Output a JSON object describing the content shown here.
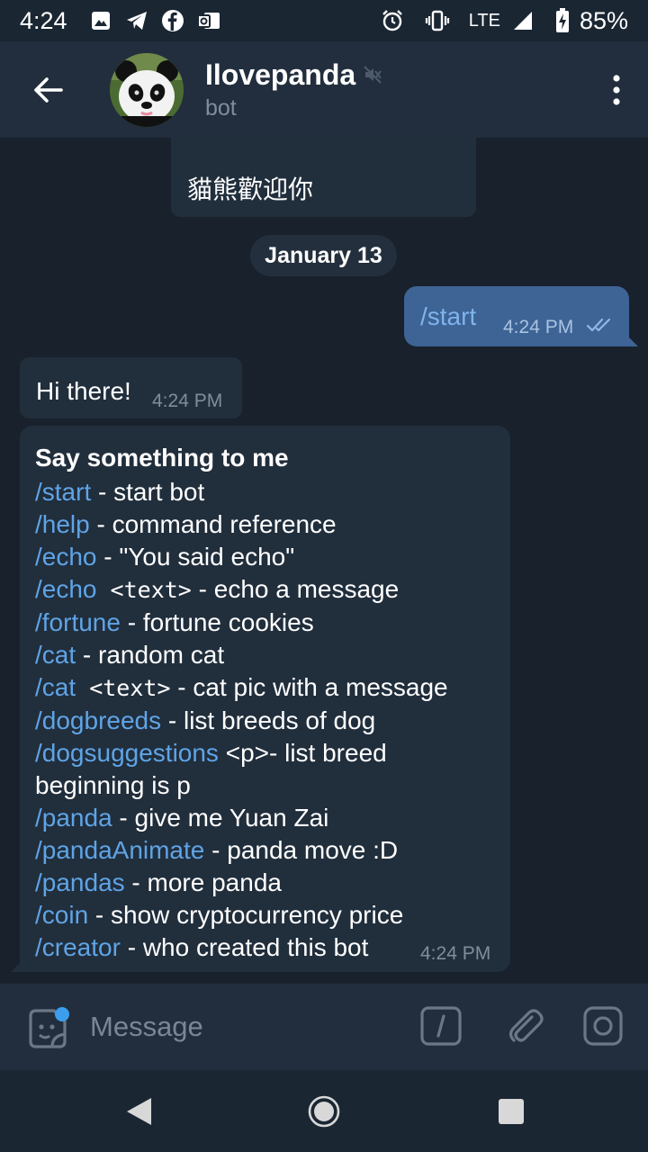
{
  "status_bar": {
    "time": "4:24",
    "network": "LTE",
    "battery": "85%",
    "icons": [
      "gallery-icon",
      "telegram-icon",
      "facebook-icon",
      "outlook-icon",
      "alarm-icon",
      "vibrate-icon",
      "signal-icon",
      "battery-charging-icon"
    ]
  },
  "header": {
    "name": "Ilovepanda",
    "subtitle": "bot",
    "muted": true
  },
  "messages": {
    "top_partial": {
      "text": "貓熊歡迎你"
    },
    "date_separator": "January 13",
    "outgoing": {
      "text": "/start",
      "time": "4:24 PM",
      "status": "read"
    },
    "hi": {
      "text": "Hi there!",
      "time": "4:24 PM"
    },
    "menu": {
      "title": "Say something to me",
      "time": "4:24 PM",
      "lines": [
        {
          "cmd": "/start",
          "arg": "",
          "desc": " - start bot"
        },
        {
          "cmd": "/help",
          "arg": "",
          "desc": " - command reference"
        },
        {
          "cmd": "/echo",
          "arg": "",
          "desc": " - \"You said echo\""
        },
        {
          "cmd": "/echo",
          "arg": " <text>",
          "desc": " - echo a message"
        },
        {
          "cmd": "/fortune",
          "arg": "",
          "desc": " - fortune cookies"
        },
        {
          "cmd": "/cat",
          "arg": "",
          "desc": " - random cat"
        },
        {
          "cmd": "/cat",
          "arg": " <text>",
          "desc": " - cat pic with a message"
        },
        {
          "cmd": "/dogbreeds",
          "arg": "",
          "desc": " - list breeds of dog"
        },
        {
          "cmd": "/dogsuggestions",
          "arg": "",
          "desc": " <p>- list breed"
        },
        {
          "cmd": "",
          "arg": "",
          "desc": "beginning is p"
        },
        {
          "cmd": "/panda",
          "arg": "",
          "desc": " - give me Yuan Zai"
        },
        {
          "cmd": "/pandaAnimate",
          "arg": "",
          "desc": " - panda move :D"
        },
        {
          "cmd": "/pandas",
          "arg": "",
          "desc": " - more panda"
        },
        {
          "cmd": "/coin",
          "arg": "",
          "desc": " - show cryptocurrency price"
        },
        {
          "cmd": "/creator",
          "arg": "",
          "desc": " - who created this bot"
        }
      ]
    }
  },
  "input": {
    "placeholder": "Message",
    "value": ""
  },
  "colors": {
    "background": "#18212c",
    "header": "#222e3d",
    "incoming_bubble": "#212e3c",
    "outgoing_bubble": "#3e6395",
    "link": "#5fa4e6"
  }
}
